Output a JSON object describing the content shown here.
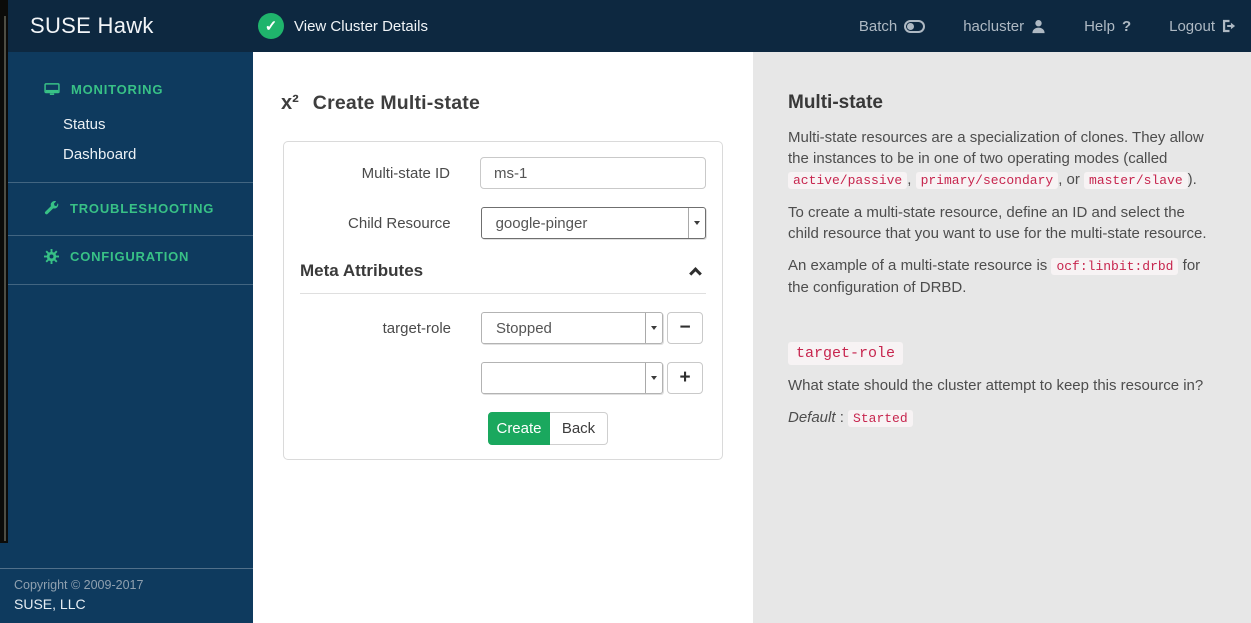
{
  "colors": {
    "header_navy": "#0d2840",
    "sidebar_navy": "#0e3a5e",
    "accent_green": "#1aa85e",
    "sidebar_green": "#38c186",
    "code_red": "#c7254e",
    "help_panel_bg": "#e7e7e7"
  },
  "icons": {
    "check": "✓",
    "help_question": "?",
    "multi_state": "x²",
    "minus": "−",
    "plus": "+"
  },
  "header": {
    "brand": "SUSE Hawk",
    "cluster_link": "View Cluster Details",
    "nav": {
      "batch": "Batch",
      "user": "hacluster",
      "help": "Help",
      "logout": "Logout"
    }
  },
  "sidebar": {
    "monitoring": "MONITORING",
    "status": "Status",
    "dashboard": "Dashboard",
    "troubleshooting": "TROUBLESHOOTING",
    "configuration": "CONFIGURATION",
    "copyright": "Copyright © 2009-2017",
    "company": "SUSE, LLC"
  },
  "form": {
    "title": "Create Multi-state",
    "fields": {
      "id_label": "Multi-state ID",
      "id_value": "ms-1",
      "child_label": "Child Resource",
      "child_value": "google-pinger",
      "meta_title": "Meta Attributes",
      "target_role_label": "target-role",
      "target_role_value": "Stopped",
      "empty_attr_value": ""
    },
    "buttons": {
      "create": "Create",
      "back": "Back"
    }
  },
  "help": {
    "title": "Multi-state",
    "p1": {
      "t1": "Multi-state resources are a specialization of clones. They allow the instances to be in one of two operating modes (called ",
      "c1": "active/passive",
      "t2": ", ",
      "c2": "primary/secondary",
      "t3": ", or ",
      "c3": "master/slave",
      "t4": ")."
    },
    "p2": "To create a multi-state resource, define an ID and select the child resource that you want to use for the multi-state resource.",
    "p3": {
      "t1": "An example of a multi-state resource is ",
      "c1": "ocf:linbit:drbd",
      "t2": " for the configuration of DRBD."
    },
    "attr": {
      "code": "target-role",
      "desc": "What state should the cluster attempt to keep this resource in?",
      "default_label": "Default",
      "separator": " : ",
      "default_value": "Started"
    }
  }
}
